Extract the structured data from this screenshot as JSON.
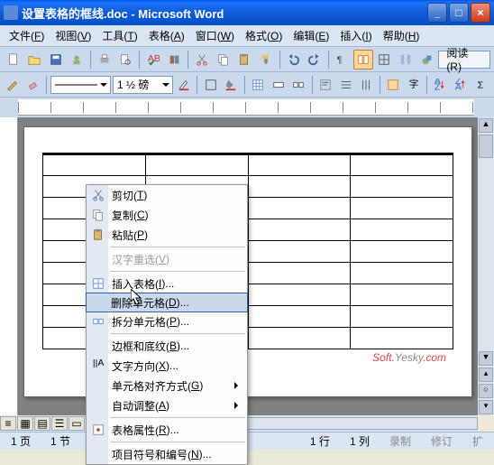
{
  "title": "设置表格的框线.doc - Microsoft Word",
  "menubar": [
    {
      "label": "文件",
      "u": "F"
    },
    {
      "label": "视图",
      "u": "V"
    },
    {
      "label": "工具",
      "u": "T"
    },
    {
      "label": "表格",
      "u": "A"
    },
    {
      "label": "窗口",
      "u": "W"
    },
    {
      "label": "格式",
      "u": "O"
    },
    {
      "label": "编辑",
      "u": "E"
    },
    {
      "label": "插入",
      "u": "I"
    },
    {
      "label": "帮助",
      "u": "H"
    }
  ],
  "help_button": "帮助",
  "read_button": "阅读(R)",
  "line_weight": "1 ½ 磅",
  "watermark": {
    "a": "Soft.",
    "b": "Yesky",
    "c": ".com"
  },
  "status": {
    "page": "1 页",
    "sec": "1 节",
    "pos": "",
    "ln": "1 行",
    "col": "1 列",
    "rec": "录制",
    "rev": "修订",
    "ext": "扩"
  },
  "context_menu": [
    {
      "label": "剪切",
      "u": "T",
      "icon": "cut"
    },
    {
      "label": "复制",
      "u": "C",
      "icon": "copy"
    },
    {
      "label": "粘贴",
      "u": "P",
      "icon": "paste"
    },
    {
      "sep": true
    },
    {
      "label": "汉字重选",
      "u": "V",
      "disabled": true
    },
    {
      "sep": true
    },
    {
      "label": "插入表格",
      "u": "I",
      "dots": true,
      "icon": "table"
    },
    {
      "label": "删除单元格",
      "u": "D",
      "dots": true,
      "highlight": true
    },
    {
      "label": "拆分单元格",
      "u": "P",
      "dots": true,
      "icon": "split"
    },
    {
      "sep": true
    },
    {
      "label": "边框和底纹",
      "u": "B",
      "dots": true
    },
    {
      "label": "文字方向",
      "u": "X",
      "dots": true,
      "icon": "textdir"
    },
    {
      "label": "单元格对齐方式",
      "u": "G",
      "sub": true
    },
    {
      "label": "自动调整",
      "u": "A",
      "sub": true
    },
    {
      "sep": true
    },
    {
      "label": "表格属性",
      "u": "R",
      "dots": true,
      "icon": "props"
    },
    {
      "sep": true
    },
    {
      "label": "项目符号和编号",
      "u": "N",
      "dots": true
    }
  ],
  "toolbar_icons": {
    "page_empty": "empty",
    "none": ""
  }
}
